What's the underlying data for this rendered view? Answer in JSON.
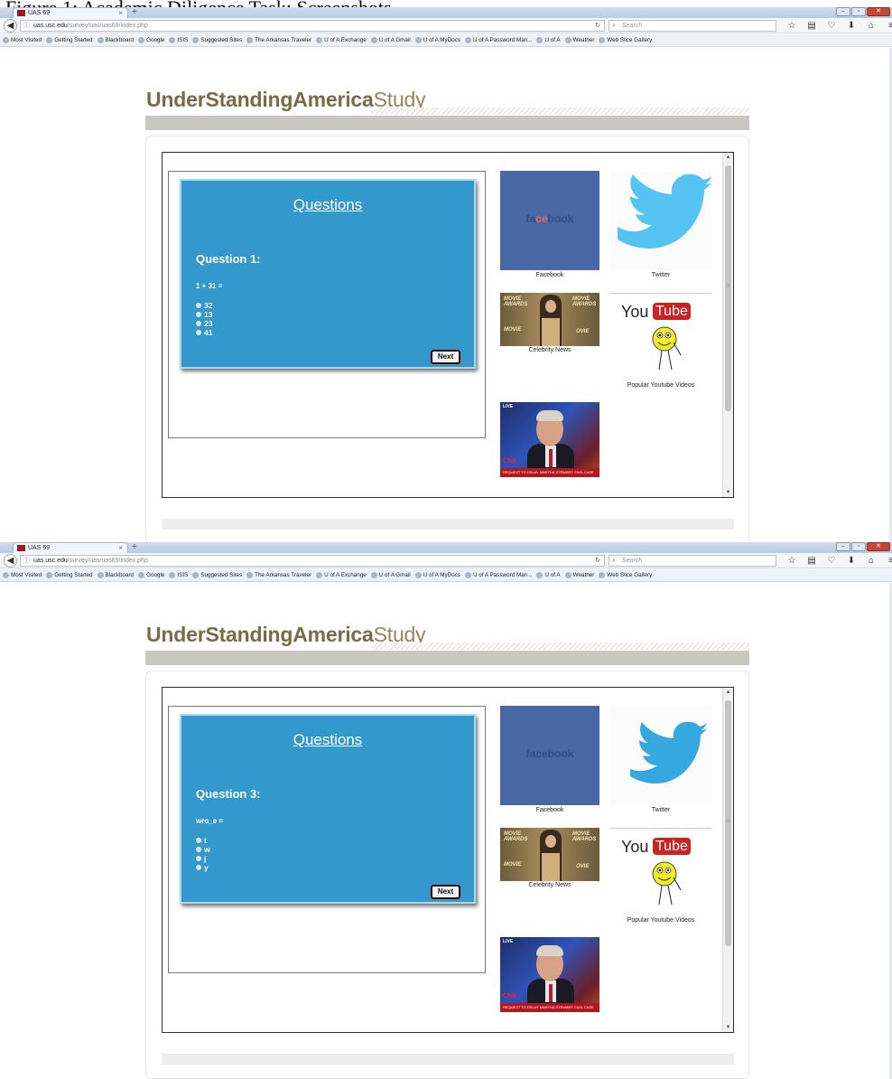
{
  "figure_caption": "Figure 1: Academic Diligence Task: Screenshots",
  "screenshots": [
    {
      "browser": {
        "tab_title": "UAS 69",
        "tab_close": "×",
        "new_tab": "+",
        "url_host": "uas.usc.edu",
        "url_path": "/survey/uas/uas69/index.php",
        "search_placeholder": "Search",
        "bookmarks": [
          "Most Visited",
          "Getting Started",
          "Blackboard",
          "Google",
          "ISIS",
          "Suggested Sites",
          "The Arkansas Traveler",
          "U of A Exchange",
          "U of A Gmail",
          "U of A MyDocs",
          "U of A Password Man...",
          "U of A",
          "Weather",
          "Web Slice Gallery"
        ]
      },
      "site_logo_bold": "UnderStandingAmerica",
      "site_logo_light": "Study",
      "question_card": {
        "heading": "Questions",
        "question_number": "Question 1:",
        "question_text": "1 + 31 =",
        "options": [
          "32",
          "13",
          "23",
          "41"
        ],
        "next_label": "Next"
      },
      "tiles": {
        "facebook": "Facebook",
        "twitter": "Twitter",
        "celebrity": "Celebrity News",
        "youtube": "Popular Youtube Videos"
      }
    },
    {
      "browser": {
        "tab_title": "UAS 69",
        "tab_close": "×",
        "new_tab": "+",
        "url_host": "uas.usc.edu",
        "url_path": "/survey/uas/uas69/index.php",
        "search_placeholder": "Search",
        "bookmarks": [
          "Most Visited",
          "Getting Started",
          "Blackboard",
          "Google",
          "ISIS",
          "Suggested Sites",
          "The Arkansas Traveler",
          "U of A Exchange",
          "U of A Gmail",
          "U of A MyDocs",
          "U of A Password Man...",
          "U of A",
          "Weather",
          "Web Slice Gallery"
        ]
      },
      "site_logo_bold": "UnderStandingAmerica",
      "site_logo_light": "Study",
      "question_card": {
        "heading": "Questions",
        "question_number": "Question 3:",
        "question_text": "wro_e =",
        "options": [
          "t",
          "w",
          "j",
          "y"
        ],
        "next_label": "Next"
      },
      "tiles": {
        "facebook": "Facebook",
        "twitter": "Twitter",
        "celebrity": "Celebrity News",
        "youtube": "Popular Youtube Videos"
      }
    }
  ]
}
